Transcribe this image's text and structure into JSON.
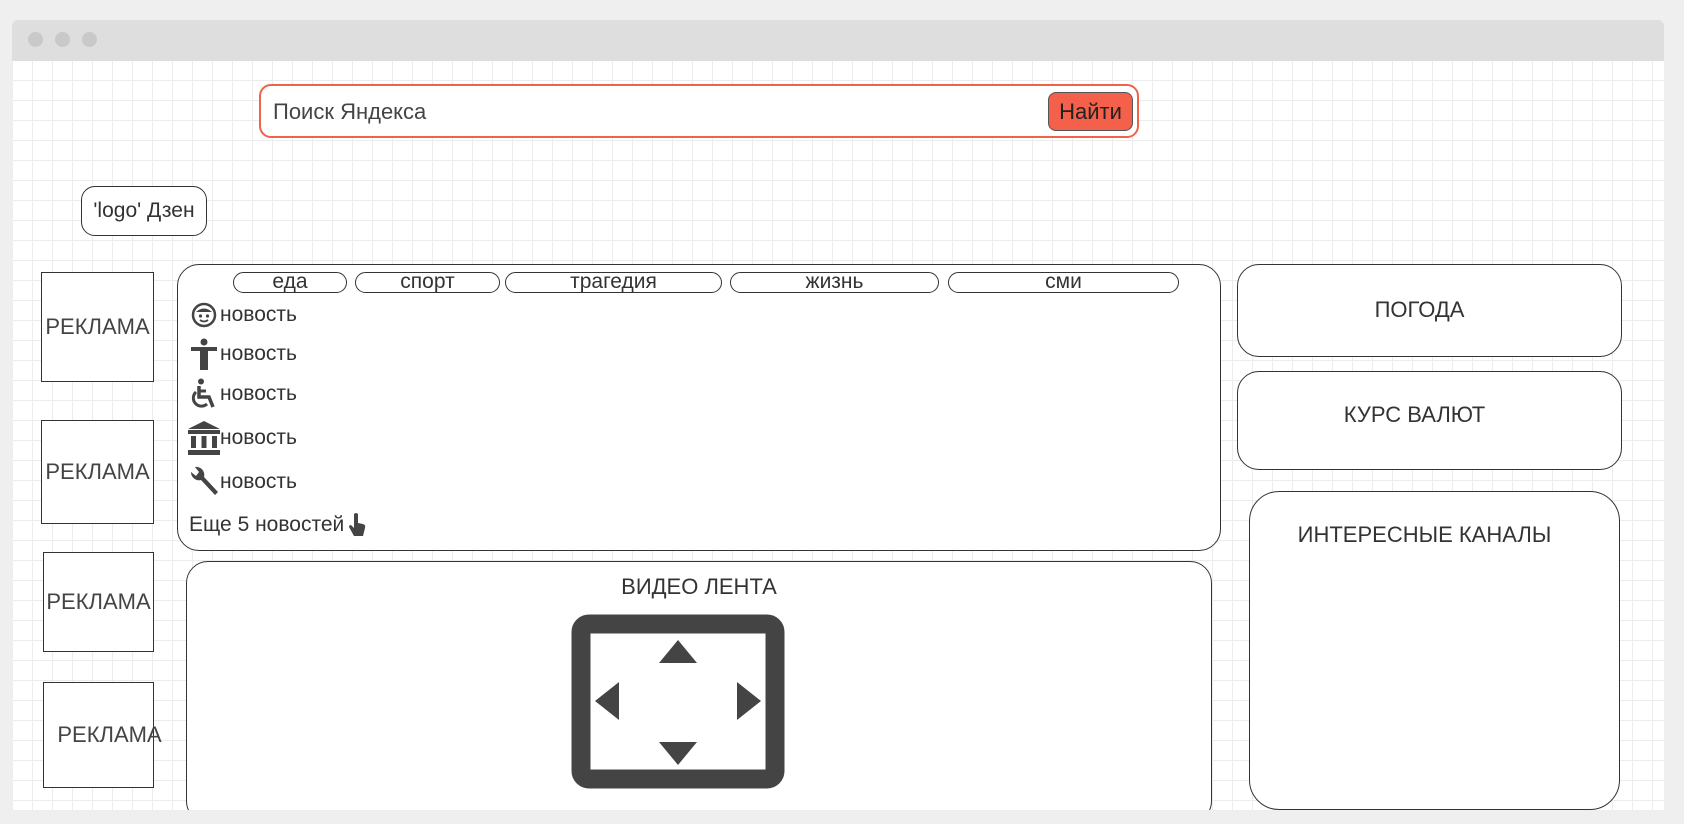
{
  "search": {
    "placeholder": "Поиск Яндекса",
    "button_label": "Найти"
  },
  "logo": {
    "label": "'logo' Дзен"
  },
  "ads": [
    "РЕКЛАМА",
    "РЕКЛАМА",
    "РЕКЛАМА",
    "РЕКЛАМА"
  ],
  "feed": {
    "tabs": [
      "еда",
      "спорт",
      "трагедия",
      "жизнь",
      "сми"
    ],
    "news": [
      {
        "icon": "smiley-face-icon",
        "label": "новость"
      },
      {
        "icon": "standing-person-icon",
        "label": "новость"
      },
      {
        "icon": "wheelchair-icon",
        "label": "новость"
      },
      {
        "icon": "bank-building-icon",
        "label": "новость"
      },
      {
        "icon": "wrench-icon",
        "label": "новость"
      }
    ],
    "more_label": "Еще 5 новостей"
  },
  "video": {
    "title": "ВИДЕО ЛЕНТА"
  },
  "widgets": {
    "weather": "ПОГОДА",
    "currency": "КУРС ВАЛЮТ",
    "channels": "ИНТЕРЕСНЫЕ КАНАЛЫ"
  },
  "colors": {
    "accent": "#f5604a",
    "border": "#333333",
    "icon": "#444444"
  }
}
